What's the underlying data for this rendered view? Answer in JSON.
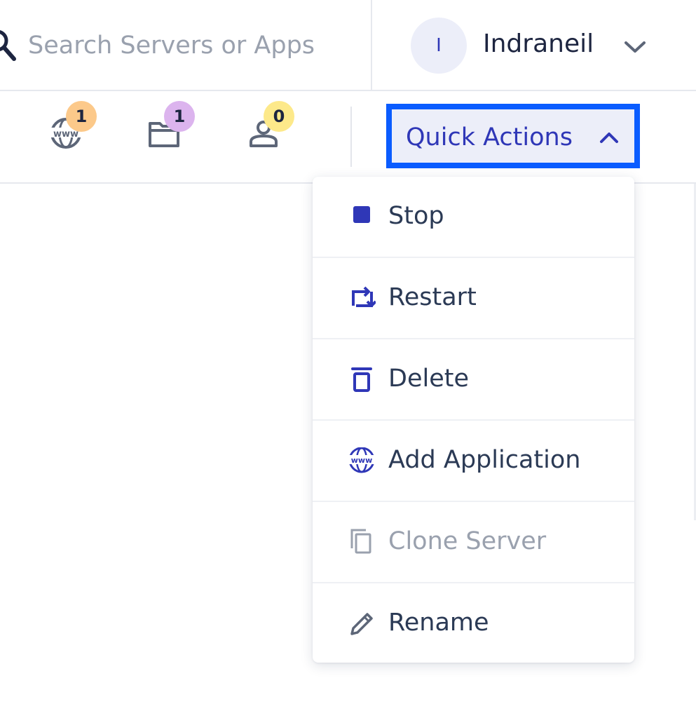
{
  "search": {
    "placeholder": "Search Servers or Apps",
    "icon": "search-icon"
  },
  "user": {
    "initial": "I",
    "name": "Indraneil",
    "icon": "chevron-down-icon"
  },
  "counters": [
    {
      "icon": "www-globe-icon",
      "count": "1",
      "badge_color": "#fcc98a"
    },
    {
      "icon": "folder-icon",
      "count": "1",
      "badge_color": "#dcb4ee"
    },
    {
      "icon": "user-icon",
      "count": "0",
      "badge_color": "#fde98a"
    }
  ],
  "quick_actions": {
    "label": "Quick Actions",
    "icon": "chevron-up-icon",
    "accent": "#0a5cff",
    "text_color": "#2f37b7"
  },
  "menu": {
    "items": [
      {
        "label": "Stop",
        "icon": "stop-icon",
        "disabled": false
      },
      {
        "label": "Restart",
        "icon": "restart-icon",
        "disabled": false
      },
      {
        "label": "Delete",
        "icon": "trash-icon",
        "disabled": false
      },
      {
        "label": "Add Application",
        "icon": "www-globe-icon",
        "disabled": false
      },
      {
        "label": "Clone Server",
        "icon": "copy-icon",
        "disabled": true
      },
      {
        "label": "Rename",
        "icon": "pencil-icon",
        "disabled": false
      }
    ]
  }
}
